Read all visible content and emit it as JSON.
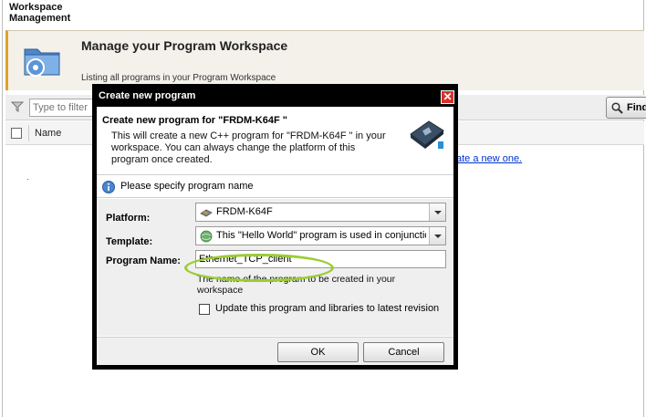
{
  "app": {
    "title": "Workspace Management"
  },
  "banner": {
    "title": "Manage your Program Workspace",
    "subtitle": "Listing all programs in your Program Workspace"
  },
  "toolbar": {
    "filter_placeholder": "Type to filter",
    "find_label": "Find"
  },
  "list": {
    "name_header": "Name",
    "create_link": "ate a new one."
  },
  "dialog": {
    "title": "Create new program",
    "close_label": "✕",
    "heading": "Create new program for \"FRDM-K64F \"",
    "description": "This will create a new C++ program for \"FRDM-K64F \" in your workspace. You can always change the platform of this program once created.",
    "info_message": "Please specify program name",
    "platform_label": "Platform:",
    "platform_value": "FRDM-K64F",
    "template_label": "Template:",
    "template_value": "This \"Hello World\" program is used in conjunction",
    "program_name_label": "Program Name:",
    "program_name_value": "Ethernet_TCP_client",
    "help_text": "The name of the program to be created in your workspace",
    "update_checkbox_label": "Update this program and libraries to latest revision",
    "ok_label": "OK",
    "cancel_label": "Cancel"
  },
  "colors": {
    "accent_orange": "#e0a12a",
    "highlight_green": "#9acd32",
    "close_red": "#d9302a",
    "link_blue": "#0033cc"
  }
}
